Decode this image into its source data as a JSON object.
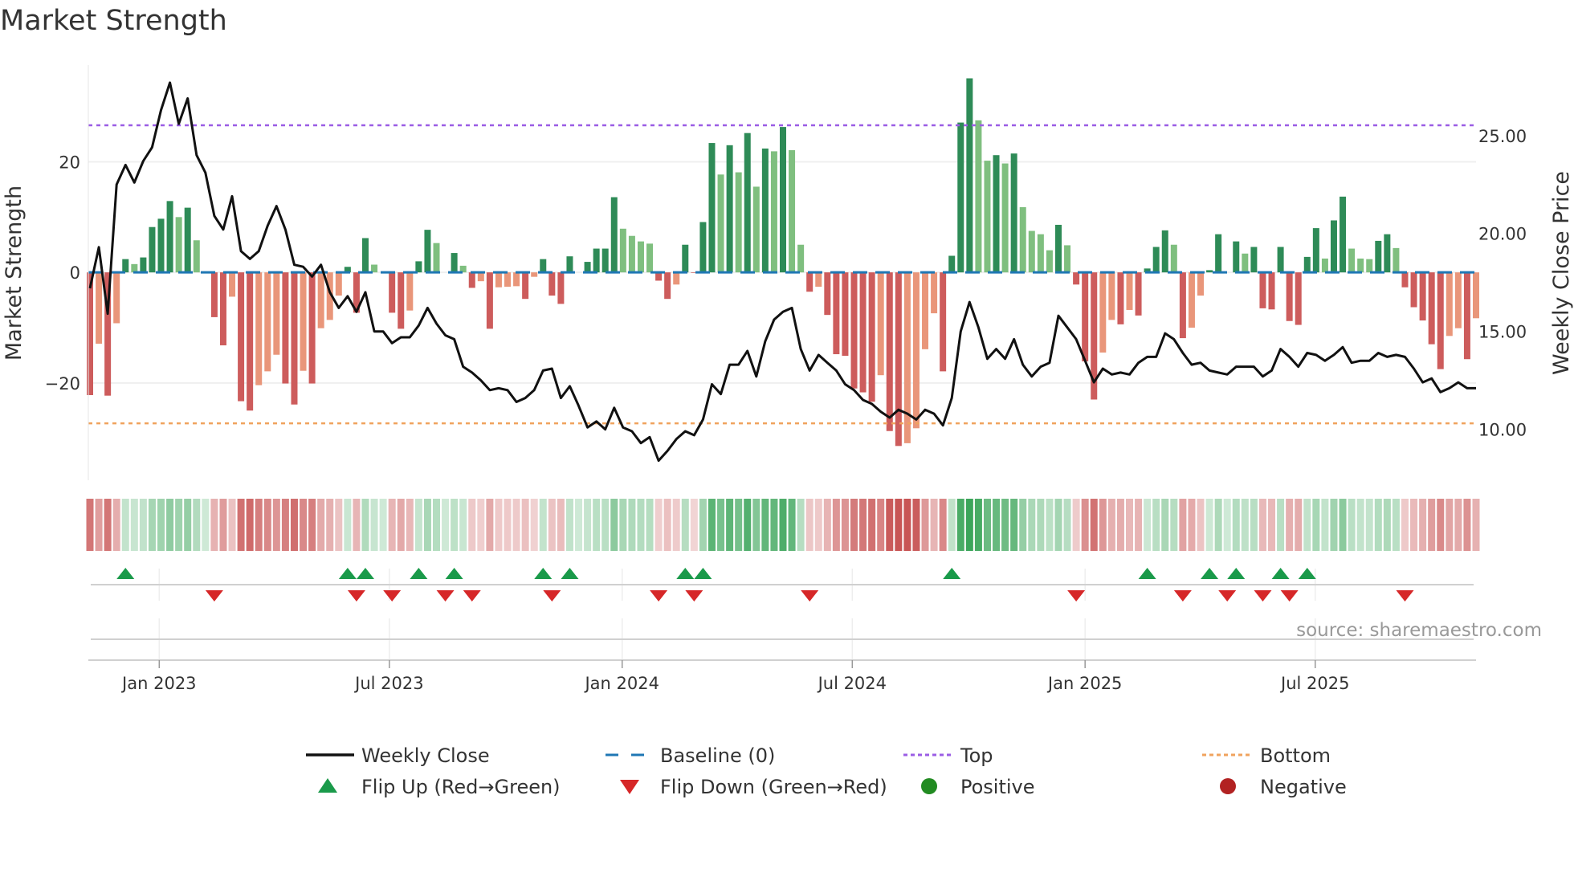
{
  "title": "Market Strength",
  "source": "source: sharemaestro.com",
  "chart_data": {
    "type": "bar+line",
    "title": "Market Strength",
    "ylabel_left": "Market Strength",
    "ylabel_right": "Weekly Close Price",
    "ylim_left": [
      -37.6,
      37.5
    ],
    "ylim_right": [
      7.4,
      28.6
    ],
    "left_ticks": [
      {
        "v": 20,
        "label": "20"
      },
      {
        "v": 0,
        "label": "0"
      },
      {
        "v": -20,
        "label": "−20"
      }
    ],
    "right_ticks": [
      {
        "v": 25,
        "label": "25.00"
      },
      {
        "v": 20,
        "label": "20.00"
      },
      {
        "v": 15,
        "label": "15.00"
      },
      {
        "v": 10,
        "label": "10.00"
      }
    ],
    "x_ticks": [
      {
        "week": 7.8,
        "label": "Jan 2023"
      },
      {
        "week": 33.7,
        "label": "Jul 2023"
      },
      {
        "week": 59.9,
        "label": "Jan 2024"
      },
      {
        "week": 85.8,
        "label": "Jul 2024"
      },
      {
        "week": 112,
        "label": "Jan 2025"
      },
      {
        "week": 137.9,
        "label": "Jul 2025"
      }
    ],
    "top_level": 26.6,
    "bottom_level": -27.3,
    "strength": [
      -22.2,
      -12.9,
      -22.3,
      -9.2,
      2.4,
      1.5,
      2.7,
      8.2,
      9.7,
      12.9,
      10.0,
      11.7,
      5.8,
      0,
      -8.1,
      -13.2,
      -4.4,
      -23.3,
      -25.0,
      -20.4,
      -17.9,
      -14.9,
      -20.1,
      -23.9,
      -17.8,
      -20.1,
      -10.1,
      -8.6,
      -4.2,
      1.0,
      -7.3,
      6.2,
      1.4,
      0,
      -7.3,
      -10.2,
      -6.9,
      2.0,
      7.7,
      5.3,
      0,
      3.5,
      1.2,
      -2.8,
      -1.6,
      -10.2,
      -2.7,
      -2.6,
      -2.5,
      -4.8,
      -0.8,
      2.4,
      -4.2,
      -5.7,
      2.9,
      0,
      1.9,
      4.3,
      4.3,
      13.6,
      7.9,
      6.6,
      5.6,
      5.2,
      -1.5,
      -4.8,
      -2.2,
      5.0,
      -0.1,
      9.1,
      23.4,
      17.7,
      23.0,
      18.1,
      25.2,
      15.5,
      22.4,
      21.9,
      26.3,
      22.1,
      5.0,
      -3.5,
      -2.6,
      -7.7,
      -14.8,
      -15.1,
      -21.0,
      -21.7,
      -23.4,
      -18.6,
      -28.7,
      -31.4,
      -30.9,
      -28.2,
      -13.9,
      -7.4,
      -17.9,
      3.0,
      27.1,
      35.1,
      27.5,
      20.2,
      21.2,
      19.7,
      21.5,
      11.8,
      7.5,
      6.9,
      4.0,
      8.6,
      4.9,
      -2.2,
      -16.1,
      -23.0,
      -14.5,
      -8.6,
      -9.4,
      -6.8,
      -7.8,
      0.7,
      4.6,
      7.6,
      5.0,
      -11.9,
      -10.0,
      -4.2,
      0.4,
      6.9,
      0,
      5.6,
      3.4,
      4.6,
      -6.5,
      -6.7,
      4.6,
      -8.8,
      -9.5,
      2.8,
      8.0,
      2.5,
      9.4,
      13.7,
      4.3,
      2.5,
      2.4,
      5.7,
      6.9,
      4.4,
      -2.7,
      -6.3,
      -8.7,
      -13.0,
      -17.5,
      -11.5,
      -10.1,
      -15.7,
      -8.3
    ],
    "weekly_close": [
      17.2,
      19.3,
      15.9,
      22.5,
      23.5,
      22.6,
      23.7,
      24.4,
      26.3,
      27.7,
      25.6,
      26.9,
      24.0,
      23.1,
      20.9,
      20.2,
      21.9,
      19.1,
      18.7,
      19.1,
      20.4,
      21.4,
      20.2,
      18.4,
      18.3,
      17.8,
      18.4,
      17.0,
      16.2,
      16.8,
      16.0,
      17.0,
      15.0,
      15.0,
      14.4,
      14.7,
      14.7,
      15.3,
      16.2,
      15.4,
      14.8,
      14.6,
      13.2,
      12.9,
      12.5,
      12.0,
      12.1,
      12.0,
      11.4,
      11.6,
      12.0,
      13.0,
      13.1,
      11.6,
      12.2,
      11.2,
      10.1,
      10.4,
      10.0,
      11.1,
      10.1,
      9.9,
      9.3,
      9.6,
      8.4,
      8.9,
      9.5,
      9.9,
      9.7,
      10.5,
      12.3,
      11.8,
      13.3,
      13.3,
      14.0,
      12.7,
      14.5,
      15.6,
      16.0,
      16.2,
      14.1,
      13.0,
      13.8,
      13.4,
      13.0,
      12.3,
      12.0,
      11.5,
      11.3,
      10.9,
      10.6,
      11.0,
      10.8,
      10.5,
      11.0,
      10.8,
      10.2,
      11.6,
      15.0,
      16.5,
      15.2,
      13.6,
      14.1,
      13.6,
      14.6,
      13.3,
      12.7,
      13.2,
      13.4,
      15.8,
      15.2,
      14.6,
      13.5,
      12.4,
      13.1,
      12.8,
      12.9,
      12.8,
      13.4,
      13.7,
      13.7,
      14.9,
      14.6,
      13.9,
      13.3,
      13.4,
      13.0,
      12.9,
      12.8,
      13.2,
      13.2,
      13.2,
      12.7,
      13.0,
      14.1,
      13.7,
      13.2,
      13.9,
      13.8,
      13.5,
      13.8,
      14.2,
      13.4,
      13.5,
      13.5,
      13.9,
      13.7,
      13.8,
      13.7,
      13.1,
      12.4,
      12.6,
      11.9,
      12.1,
      12.4,
      12.1,
      12.1
    ],
    "flip_up_weeks": [
      4,
      29,
      31,
      37,
      41,
      51,
      54,
      67,
      69,
      97,
      119,
      126,
      129,
      134,
      137
    ],
    "flip_down_weeks": [
      14,
      30,
      34,
      40,
      43,
      52,
      64,
      68,
      81,
      111,
      123,
      128,
      132,
      135,
      148
    ],
    "colors": {
      "pos_rising": "#2e8b57",
      "pos_falling": "#7fbf7f",
      "neg_falling": "#cd5c5c",
      "neg_rising": "#e9967a",
      "baseline": "#1f77b4",
      "top": "#9b5de5",
      "bottom": "#f0a35e",
      "line": "#111111",
      "flip_up": "#1a9a4a",
      "flip_down": "#d62728",
      "positive": "#228b22",
      "negative": "#b22222"
    },
    "legend": [
      {
        "label": "Weekly Close",
        "kind": "line"
      },
      {
        "label": "Baseline (0)",
        "kind": "baseline"
      },
      {
        "label": "Top",
        "kind": "top"
      },
      {
        "label": "Bottom",
        "kind": "bottom"
      },
      {
        "label": "Flip Up (Red→Green)",
        "kind": "up"
      },
      {
        "label": "Flip Down (Green→Red)",
        "kind": "down"
      },
      {
        "label": "Positive",
        "kind": "pos"
      },
      {
        "label": "Negative",
        "kind": "neg"
      }
    ]
  }
}
